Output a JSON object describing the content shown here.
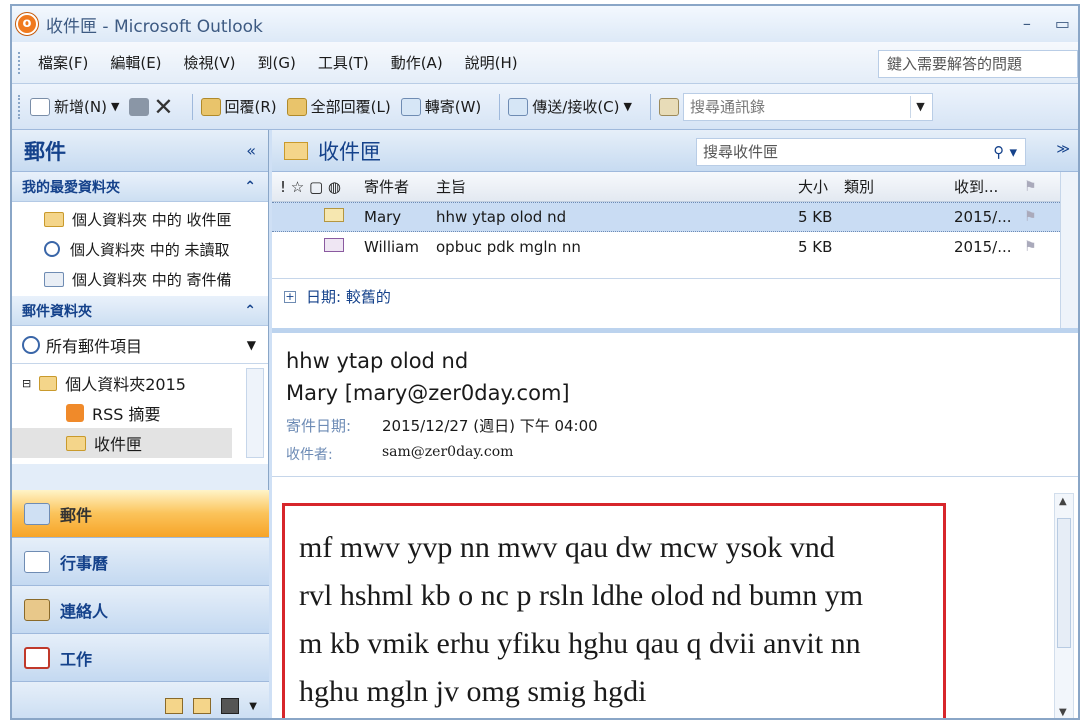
{
  "window": {
    "title": "收件匣 - Microsoft Outlook",
    "minimize": "–",
    "maximize": "▭"
  },
  "menubar": {
    "items": [
      "檔案(F)",
      "編輯(E)",
      "檢視(V)",
      "到(G)",
      "工具(T)",
      "動作(A)",
      "說明(H)"
    ],
    "ask_placeholder": "鍵入需要解答的問題"
  },
  "toolbar": {
    "new_label": "新增(N)",
    "reply_label": "回覆(R)",
    "reply_all_label": "全部回覆(L)",
    "forward_label": "轉寄(W)",
    "send_receive_label": "傳送/接收(C)",
    "address_search_placeholder": "搜尋通訊錄"
  },
  "nav": {
    "title": "郵件",
    "collapse": "«",
    "favorites_header": "我的最愛資料夾",
    "favorites": [
      "個人資料夾 中的 收件匣",
      "個人資料夾 中的 未讀取",
      "個人資料夾 中的 寄件備"
    ],
    "mail_folders_header": "郵件資料夾",
    "all_items_label": "所有郵件項目",
    "tree": {
      "root": "個人資料夾2015",
      "rss": "RSS 摘要",
      "inbox": "收件匣"
    },
    "buttons": [
      "郵件",
      "行事曆",
      "連絡人",
      "工作"
    ]
  },
  "inbox": {
    "title": "收件匣",
    "search_placeholder": "搜尋收件匣",
    "columns": {
      "from": "寄件者",
      "subject": "主旨",
      "size": "大小",
      "category": "類別",
      "received": "收到..."
    },
    "messages": [
      {
        "from": "Mary",
        "subject": "hhw ytap olod nd",
        "size": "5 KB",
        "received": "2015/..."
      },
      {
        "from": "William",
        "subject": "opbuc pdk mgln nn",
        "size": "5 KB",
        "received": "2015/..."
      }
    ],
    "group_label": "日期: 較舊的"
  },
  "reading": {
    "subject": "hhw ytap olod nd",
    "from": "Mary [mary@zer0day.com]",
    "sent_label": "寄件日期:",
    "sent_value": "2015/12/27 (週日) 下午 04:00",
    "to_label": "收件者:",
    "to_value": "sam@zer0day.com",
    "body_lines": [
      "mf mwv yvp nn mwv qau dw mcw ysok vnd",
      "rvl hshml kb o nc p rsln ldhe olod nd bumn ym",
      "m kb vmik erhu yfiku hghu qau q dvii anvit nn",
      "hghu mgln jv omg smig hgdi"
    ]
  },
  "colors": {
    "accent": "#15428b",
    "highlight_border": "#d7262b",
    "active_nav": "#f7a428"
  }
}
